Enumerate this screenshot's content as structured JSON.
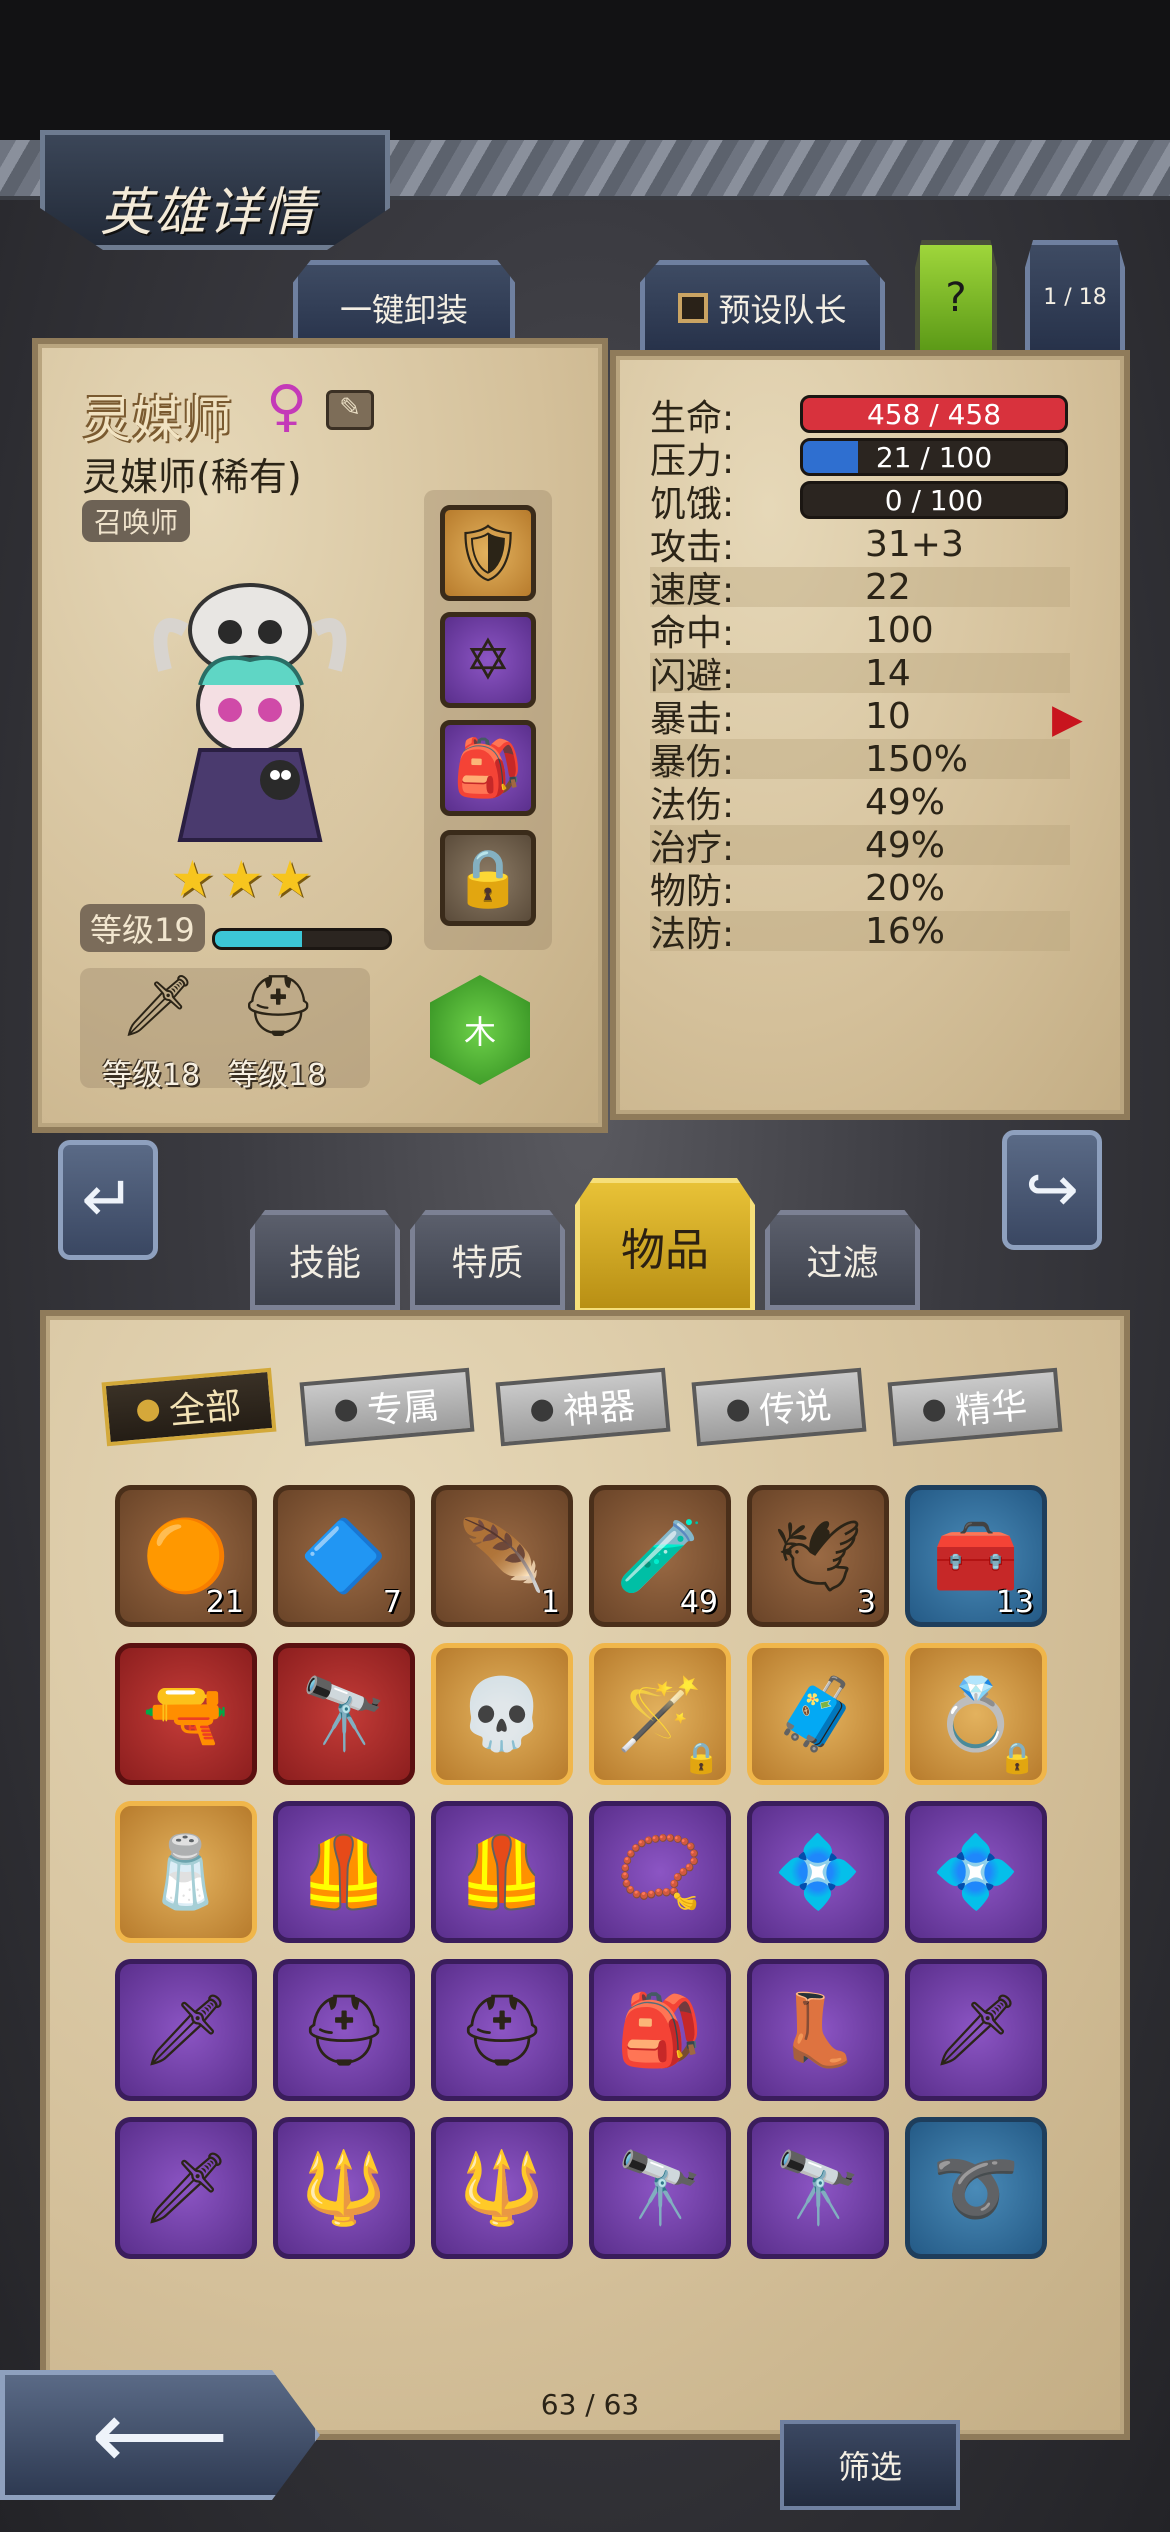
{
  "header": {
    "title": "英雄详情"
  },
  "top_buttons": {
    "unequip_all": "一键卸装",
    "preset_captain": "预设队长",
    "help": "?",
    "page_index": "1 / 18"
  },
  "hero": {
    "name": "灵媒师",
    "gender_symbol": "♀",
    "class_rarity": "灵媒师(稀有)",
    "role": "召唤师",
    "level_label": "等级19",
    "level_progress": 0.5,
    "stars": 3,
    "weapon_level": "等级18",
    "armor_level": "等级18",
    "element": "木"
  },
  "bars": {
    "hp": {
      "label": "生命:",
      "text": "458 / 458",
      "fraction": 1.0,
      "color": "#d8323d"
    },
    "stress": {
      "label": "压力:",
      "text": "21 / 100",
      "fraction": 0.21,
      "color": "#2f6fd0"
    },
    "hunger": {
      "label": "饥饿:",
      "text": "0 / 100",
      "fraction": 0.0,
      "color": "#777777"
    }
  },
  "stats": [
    {
      "label": "攻击:",
      "value": "31+3"
    },
    {
      "label": "速度:",
      "value": "22"
    },
    {
      "label": "命中:",
      "value": "100"
    },
    {
      "label": "闪避:",
      "value": "14"
    },
    {
      "label": "暴击:",
      "value": "10"
    },
    {
      "label": "暴伤:",
      "value": "150%"
    },
    {
      "label": "法伤:",
      "value": "49%"
    },
    {
      "label": "治疗:",
      "value": "49%"
    },
    {
      "label": "物防:",
      "value": "20%"
    },
    {
      "label": "法防:",
      "value": "16%"
    }
  ],
  "category_tabs": [
    "技能",
    "特质",
    "物品",
    "过滤"
  ],
  "active_category": "物品",
  "filters": [
    "全部",
    "专属",
    "神器",
    "传说",
    "精华"
  ],
  "items": [
    [
      "🟠",
      "21",
      "brown",
      false
    ],
    [
      "🔷",
      "7",
      "brown",
      false
    ],
    [
      "🪶",
      "1",
      "brown",
      false
    ],
    [
      "🧪",
      "49",
      "brown",
      false
    ],
    [
      "🕊",
      "3",
      "brown",
      false
    ],
    [
      "🧰",
      "13",
      "blue",
      false
    ],
    [
      "🔫",
      "",
      "red",
      false
    ],
    [
      "🔭",
      "",
      "red",
      false
    ],
    [
      "💀",
      "",
      "orange",
      false
    ],
    [
      "🪄",
      "",
      "orange",
      true
    ],
    [
      "🧳",
      "",
      "orange",
      false
    ],
    [
      "💍",
      "",
      "orange",
      true
    ],
    [
      "🧂",
      "",
      "orange",
      false
    ],
    [
      "🦺",
      "",
      "purple",
      false
    ],
    [
      "🦺",
      "",
      "purple",
      false
    ],
    [
      "📿",
      "",
      "purple",
      false
    ],
    [
      "💠",
      "",
      "purple",
      false
    ],
    [
      "💠",
      "",
      "purple",
      false
    ],
    [
      "🗡",
      "",
      "purple",
      false
    ],
    [
      "⛑",
      "",
      "purple",
      false
    ],
    [
      "⛑",
      "",
      "purple",
      false
    ],
    [
      "🎒",
      "",
      "purple",
      false
    ],
    [
      "👢",
      "",
      "purple",
      false
    ],
    [
      "🗡",
      "",
      "purple",
      false
    ],
    [
      "🗡",
      "",
      "purple",
      false
    ],
    [
      "🔱",
      "",
      "purple",
      false
    ],
    [
      "🔱",
      "",
      "purple",
      false
    ],
    [
      "🔭",
      "",
      "purple",
      false
    ],
    [
      "🔭",
      "",
      "purple",
      false
    ],
    [
      "➰",
      "",
      "blue",
      false
    ],
    [
      "➰",
      "",
      "blue",
      false
    ],
    [
      "🦾",
      "",
      "purple",
      false
    ],
    [
      "🦾",
      "",
      "purple",
      false
    ],
    [
      "💍",
      "",
      "blue",
      false
    ],
    [
      "💍",
      "",
      "blue",
      false
    ],
    [
      "📿",
      "",
      "blue",
      false
    ]
  ],
  "inventory_count": "63 / 63",
  "bottom": {
    "filter_button": "筛选"
  }
}
